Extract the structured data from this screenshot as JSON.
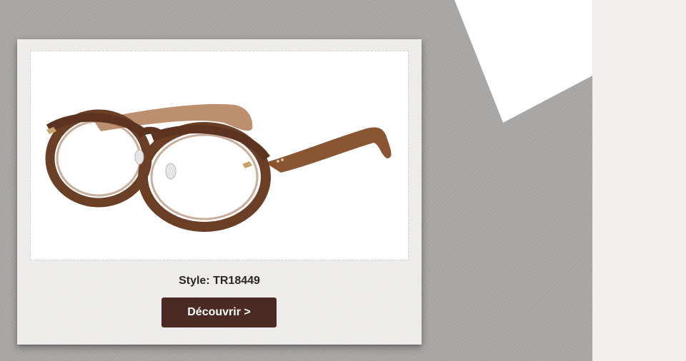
{
  "product": {
    "style_label": "Style: TR18449",
    "cta_label": "Découvrir >",
    "image_icon": "eyeglasses-icon"
  },
  "colors": {
    "background_gray": "#a9a7a5",
    "card": "#efeeec",
    "button": "#4a2a22",
    "frame_brown": "#6b3f26"
  }
}
